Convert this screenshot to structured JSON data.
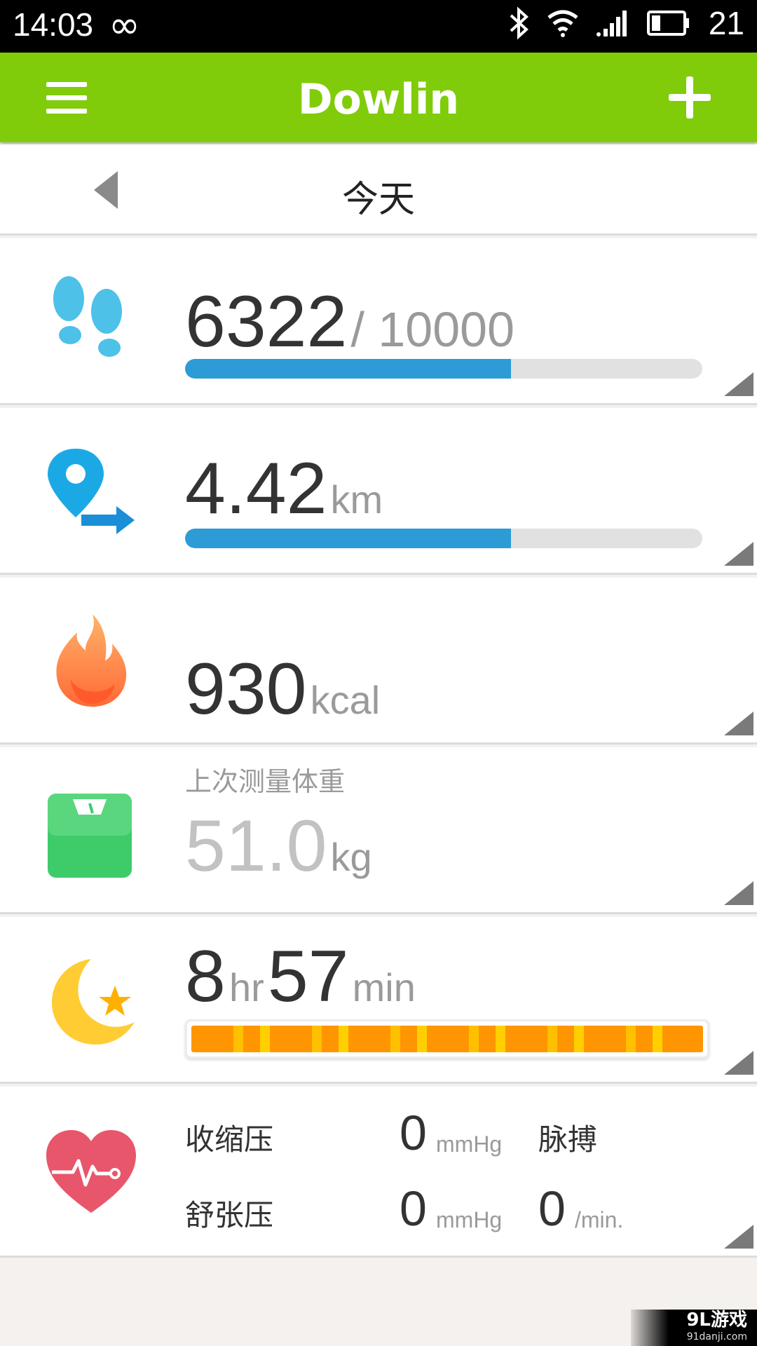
{
  "status_bar": {
    "time": "14:03",
    "battery": "21"
  },
  "app_bar": {
    "title": "Dowlin"
  },
  "date_nav": {
    "label": "今天"
  },
  "steps": {
    "value": "6322",
    "goal": "/ 10000",
    "progress": 0.63
  },
  "distance": {
    "value": "4.42",
    "unit": "km",
    "progress": 0.63
  },
  "calories": {
    "value": "930",
    "unit": "kcal"
  },
  "weight": {
    "label": "上次测量体重",
    "value": "51.0",
    "unit": "kg"
  },
  "sleep": {
    "hours": "8",
    "hours_unit": "hr",
    "minutes": "57",
    "minutes_unit": "min"
  },
  "blood_pressure": {
    "systolic_label": "收缩压",
    "systolic_value": "0",
    "systolic_unit": "mmHg",
    "diastolic_label": "舒张压",
    "diastolic_value": "0",
    "diastolic_unit": "mmHg",
    "pulse_label": "脉搏",
    "pulse_value": "0",
    "pulse_unit": "/min."
  },
  "watermark": {
    "main": "9L游戏",
    "sub": "91danji.com"
  },
  "colors": {
    "app_bar": "#80cc0a",
    "progress": "#2d9bd6",
    "sleep": "#ff9500"
  }
}
